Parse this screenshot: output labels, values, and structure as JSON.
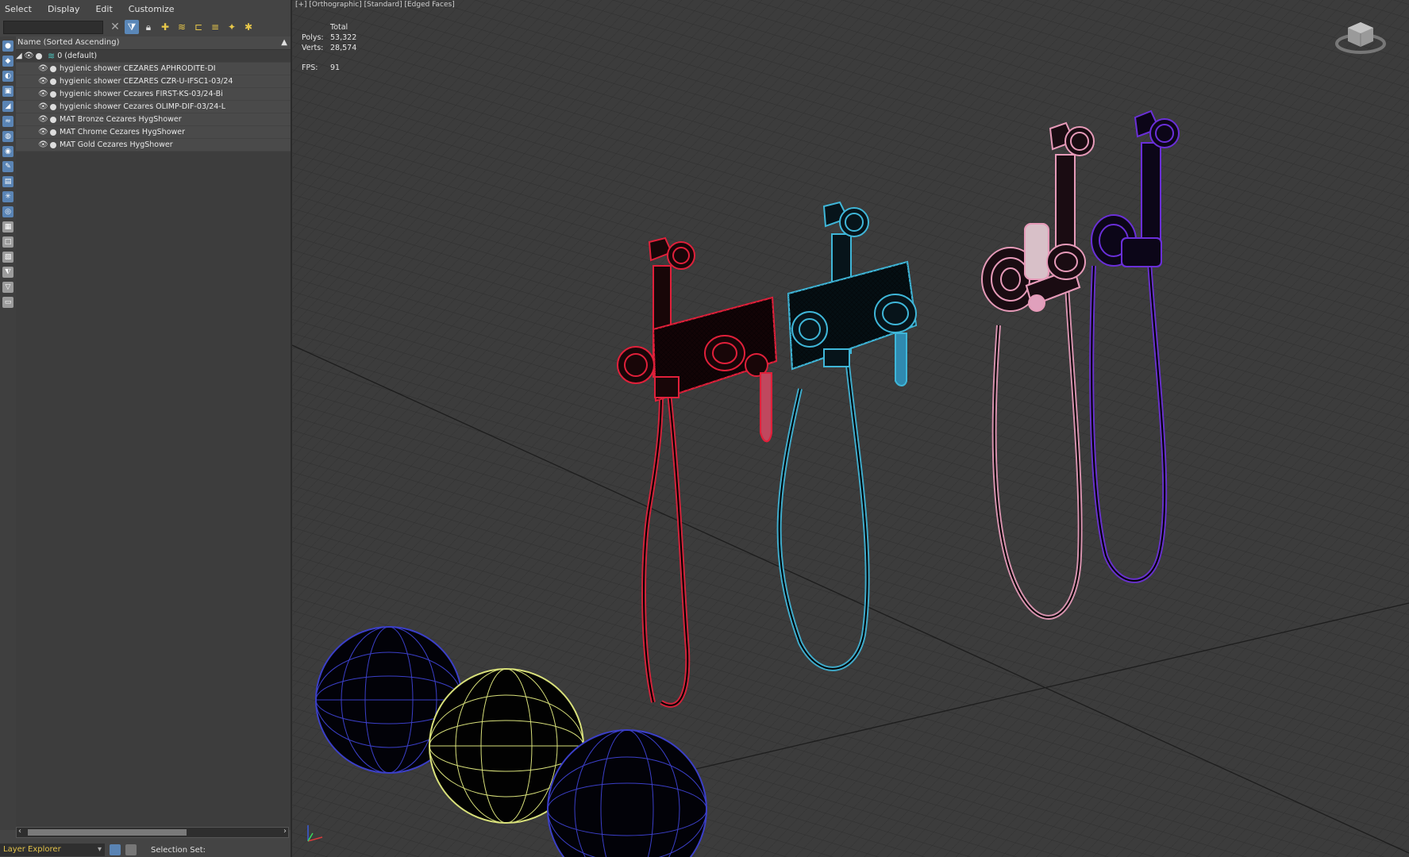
{
  "menu": [
    "Select",
    "Display",
    "Edit",
    "Customize"
  ],
  "tree": {
    "column_header": "Name (Sorted Ascending)",
    "root": "0 (default)",
    "items": [
      "hygienic shower CEZARES APHRODITE-DI",
      "hygienic shower CEZARES CZR-U-IFSC1-03/24",
      "hygienic shower Cezares FIRST-KS-03/24-Bi",
      "hygienic shower Cezares OLIMP-DIF-03/24-L",
      "MAT Bronze Cezares HygShower",
      "MAT Chrome Cezares HygShower",
      "MAT Gold Cezares HygShower"
    ]
  },
  "status": {
    "explorer": "Layer Explorer",
    "selection_set": "Selection Set:"
  },
  "viewport": {
    "label": "[+] [Orthographic] [Standard] [Edged Faces]",
    "stats": {
      "total_label": "Total",
      "polys_label": "Polys:",
      "polys": "53,322",
      "verts_label": "Verts:",
      "verts": "28,574",
      "fps_label": "FPS:",
      "fps": "91"
    }
  },
  "colors": {
    "red": "#e0203a",
    "cyan": "#3fb6d8",
    "pink": "#e69ab8",
    "purple": "#6a2fd8",
    "blue_sphere": "#3b3fc8",
    "yellow_sphere": "#d8e07a"
  }
}
